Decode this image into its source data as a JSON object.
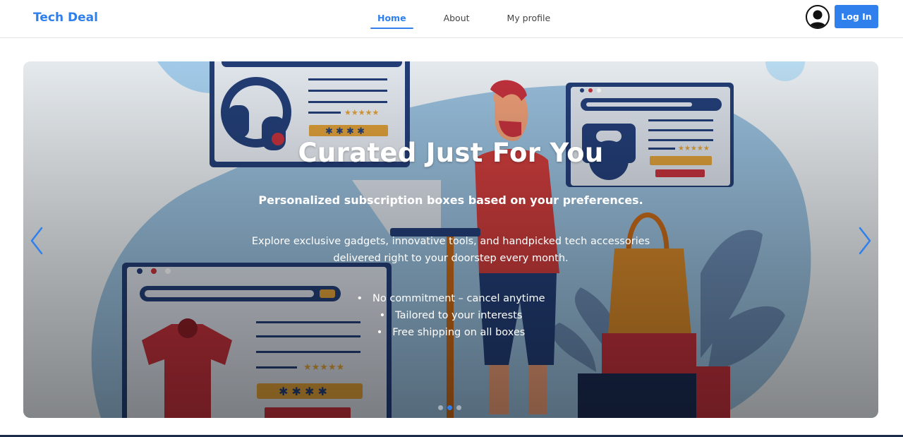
{
  "navbar": {
    "brand": "Tech Deal",
    "links": [
      {
        "label": "Home",
        "active": true
      },
      {
        "label": "About",
        "active": false
      },
      {
        "label": "My profile",
        "active": false
      }
    ],
    "login_label": "Log In",
    "accent": "#2f80ed"
  },
  "carousel": {
    "title": "Curated Just For You",
    "subtitle": "Personalized subscription boxes based on your preferences.",
    "description": "Explore exclusive gadgets, innovative tools, and handpicked tech accessories delivered right to your doorstep every month.",
    "features": [
      "No commitment – cancel anytime",
      "Tailored to your interests",
      "Free shipping on all boxes"
    ],
    "prev_icon": "chevron-left-icon",
    "next_icon": "chevron-right-icon",
    "slide_count": 3,
    "active_slide": 2
  }
}
